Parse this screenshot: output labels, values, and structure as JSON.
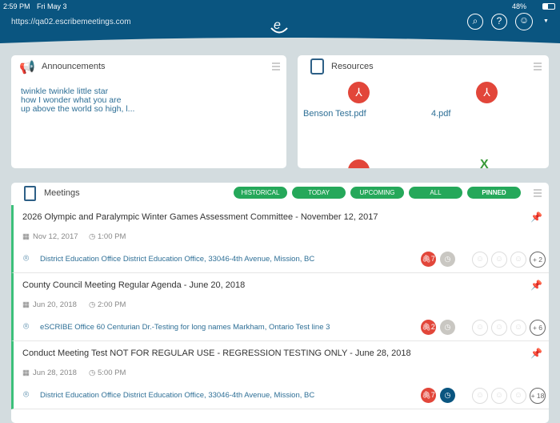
{
  "status": {
    "time": "2:59 PM",
    "date": "Fri May 3",
    "battery": "48%"
  },
  "header": {
    "url": "https://qa02.escribemeetings.com",
    "logo": "e"
  },
  "announcements": {
    "title": "Announcements",
    "lines": [
      "twinkle twinkle little star",
      "how I wonder what you are",
      "up above the world so high, l..."
    ]
  },
  "resources": {
    "title": "Resources",
    "files": [
      "Benson Test.pdf",
      "4.pdf"
    ]
  },
  "meetings": {
    "title": "Meetings",
    "filters": [
      "HISTORICAL",
      "TODAY",
      "UPCOMING",
      "ALL",
      "PINNED"
    ],
    "items": [
      {
        "title": "2026 Olympic and Paralympic Winter Games Assessment Committee - November 12, 2017",
        "date": "Nov 12, 2017",
        "time": "1:00 PM",
        "location": "District Education Office District Education Office, 33046-4th Avenue, Mission, BC",
        "attachments": "7",
        "more": "+ 2"
      },
      {
        "title": "County Council Meeting Regular Agenda - June 20, 2018",
        "date": "Jun 20, 2018",
        "time": "2:00 PM",
        "location": "eSCRIBE Office 60 Centurian Dr.-Testing for long names Markham, Ontario Test line 3",
        "attachments": "2",
        "more": "+ 6"
      },
      {
        "title": "Conduct Meeting Test NOT FOR REGULAR USE - REGRESSION TESTING ONLY - June 28, 2018",
        "date": "Jun 28, 2018",
        "time": "5:00 PM",
        "location": "District Education Office District Education Office, 33046-4th Avenue, Mission, BC",
        "attachments": "7",
        "more": "+ 18"
      }
    ]
  },
  "colors": {
    "header": "#0a5580",
    "accent": "#25a85a",
    "pdf": "#e2463a"
  }
}
